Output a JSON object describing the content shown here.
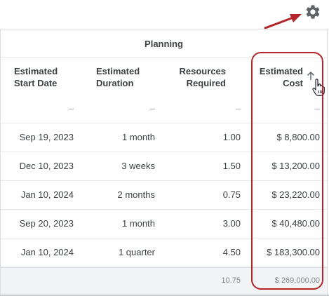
{
  "group_header": "Planning",
  "columns": [
    {
      "line1": "Estimated",
      "line2": "Start Date"
    },
    {
      "line1": "Estimated",
      "line2": "Duration"
    },
    {
      "line1": "Resources",
      "line2": "Required"
    },
    {
      "line1": "Estimated",
      "line2": "Cost"
    }
  ],
  "filter_placeholder": "–",
  "rows": [
    {
      "start": "Sep 19, 2023",
      "duration": "1 month",
      "resources": "1.00",
      "cost": "$ 8,800.00"
    },
    {
      "start": "Dec 10, 2023",
      "duration": "3 weeks",
      "resources": "1.50",
      "cost": "$ 13,200.00"
    },
    {
      "start": "Jan 10, 2024",
      "duration": "2 months",
      "resources": "0.75",
      "cost": "$ 23,220.00"
    },
    {
      "start": "Sep 20, 2023",
      "duration": "1 month",
      "resources": "3.00",
      "cost": "$ 40,480.00"
    },
    {
      "start": "Jan 10, 2024",
      "duration": "1 quarter",
      "resources": "4.50",
      "cost": "$ 183,300.00"
    }
  ],
  "totals": {
    "resources": "10.75",
    "cost": "$ 269,000.00"
  },
  "icons": {
    "settings": "gear-icon",
    "sort": "arrow-up-icon",
    "cursor": "hand-pointer-icon"
  },
  "colors": {
    "annotation": "#b3262b",
    "header_text": "#3c4043",
    "muted": "#9aa0a6",
    "total_bg": "#f1f3f4"
  }
}
